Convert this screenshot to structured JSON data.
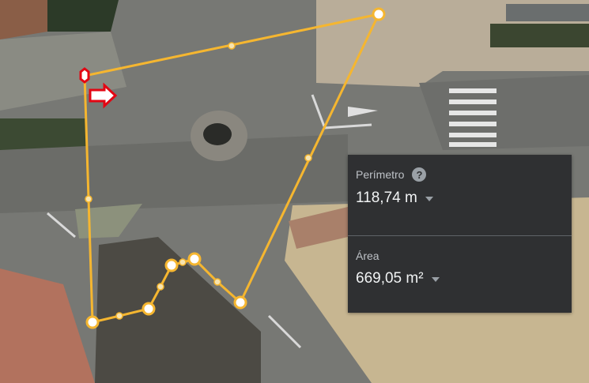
{
  "measure": {
    "perimeter_label": "Perímetro",
    "perimeter_value": "118,74 m",
    "area_label": "Área",
    "area_value": "669,05 m²"
  },
  "icons": {
    "help": "help-icon",
    "dropdown": "chevron-down-icon",
    "point": "measure-point-icon"
  },
  "colors": {
    "measure_line": "#f5b630",
    "panel_bg": "#2f3032",
    "marker": "#e30613"
  }
}
